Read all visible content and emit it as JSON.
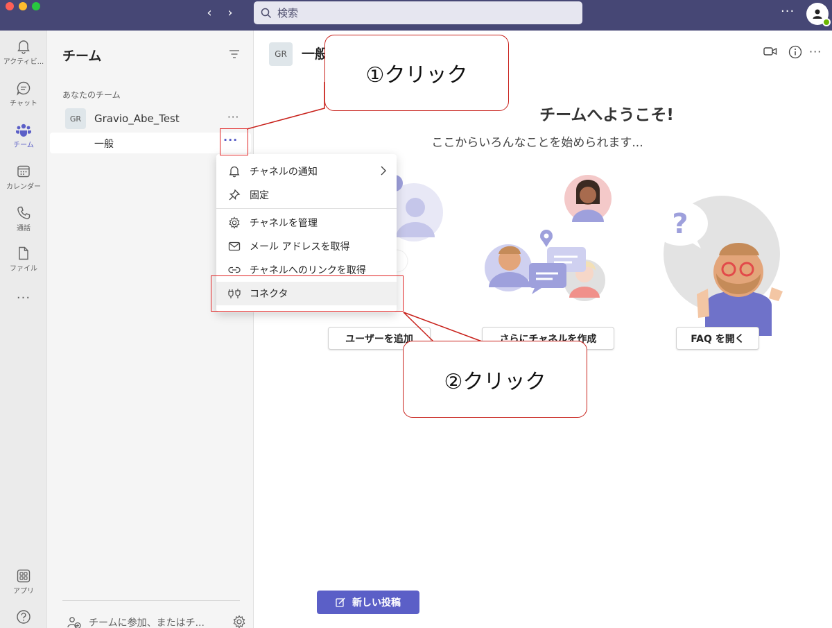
{
  "titlebar": {
    "search_placeholder": "検索",
    "more": "···"
  },
  "appbar": {
    "items": [
      {
        "label": "アクティビ...",
        "icon": "bell-icon"
      },
      {
        "label": "チャット",
        "icon": "chat-icon"
      },
      {
        "label": "チーム",
        "icon": "teams-icon",
        "active": true
      },
      {
        "label": "カレンダー",
        "icon": "calendar-icon"
      },
      {
        "label": "通話",
        "icon": "phone-icon"
      },
      {
        "label": "ファイル",
        "icon": "file-icon"
      }
    ],
    "more": "···",
    "apps_label": "アプリ"
  },
  "teams_panel": {
    "title": "チーム",
    "section_label": "あなたのチーム",
    "team": {
      "avatar": "GR",
      "name": "Gravio_Abe_Test",
      "more": "···"
    },
    "channel": {
      "name": "一般",
      "more": "···"
    },
    "join_label": "チームに参加、またはチ..."
  },
  "channel_header": {
    "avatar": "GR",
    "title": "一般"
  },
  "welcome": {
    "title": "チームへようこそ!",
    "subtitle": "ここからいろんなことを始められます...",
    "buttons": [
      "ユーザーを追加",
      "さらにチャネルを作成",
      "FAQ を開く"
    ],
    "question_mark": "?"
  },
  "new_post_label": "新しい投稿",
  "context_menu": {
    "items": [
      {
        "label": "チャネルの通知",
        "icon": "bell-icon",
        "submenu": true
      },
      {
        "label": "固定",
        "icon": "pin-icon"
      },
      {
        "label": "チャネルを管理",
        "icon": "gear-icon"
      },
      {
        "label": "メール アドレスを取得",
        "icon": "mail-icon"
      },
      {
        "label": "チャネルへのリンクを取得",
        "icon": "link-icon"
      },
      {
        "label": "コネクタ",
        "icon": "connector-icon",
        "highlighted": true
      }
    ]
  },
  "annotations": {
    "callout_1": "①クリック",
    "callout_2": "②クリック"
  },
  "colors": {
    "titlebar": "#464775",
    "accent": "#5b5fc7",
    "annotation": "#e02020"
  }
}
